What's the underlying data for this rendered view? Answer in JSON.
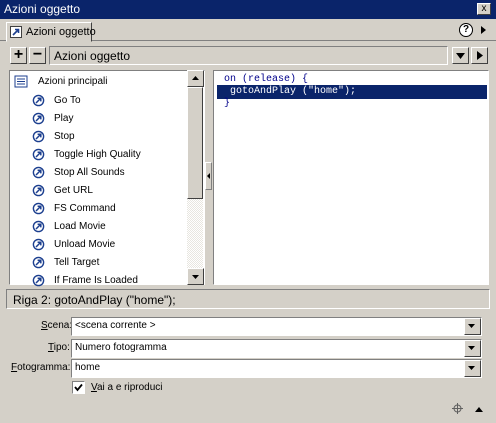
{
  "window": {
    "title": "Azioni oggetto",
    "close_glyph": "x"
  },
  "tab": {
    "label": "Azioni oggetto",
    "icon": "arrow-action-icon"
  },
  "toolbar": {
    "add_glyph": "+",
    "remove_glyph": "−",
    "header_label": "Azioni oggetto",
    "help_glyph": "?"
  },
  "actions_list": {
    "category": "Azioni principali",
    "items": [
      {
        "label": "Go To"
      },
      {
        "label": "Play"
      },
      {
        "label": "Stop"
      },
      {
        "label": "Toggle High Quality"
      },
      {
        "label": "Stop All Sounds"
      },
      {
        "label": "Get URL"
      },
      {
        "label": "FS Command"
      },
      {
        "label": "Load Movie"
      },
      {
        "label": "Unload Movie"
      },
      {
        "label": "Tell Target"
      },
      {
        "label": "If Frame Is Loaded"
      }
    ]
  },
  "code": {
    "lines": [
      "on (release) {",
      " gotoAndPlay (\"home\");",
      "}"
    ],
    "selected_line": 2
  },
  "status": {
    "text": "Riga 2: gotoAndPlay (\"home\");"
  },
  "form": {
    "scene": {
      "label_u": "S",
      "label_rest": "cena:",
      "value": "<scena corrente >"
    },
    "type": {
      "label_u": "T",
      "label_rest": "ipo:",
      "value": "Numero fotogramma"
    },
    "frame": {
      "label_u": "F",
      "label_rest": "otogramma:",
      "value": "home"
    },
    "play_checkbox": {
      "label_u": "V",
      "label_rest": "ai a e riproduci",
      "checked": true
    }
  },
  "colors": {
    "titlebar": "#0a246a",
    "face": "#d4d0c8",
    "code": "#00008b",
    "selection": "#0a246a"
  }
}
